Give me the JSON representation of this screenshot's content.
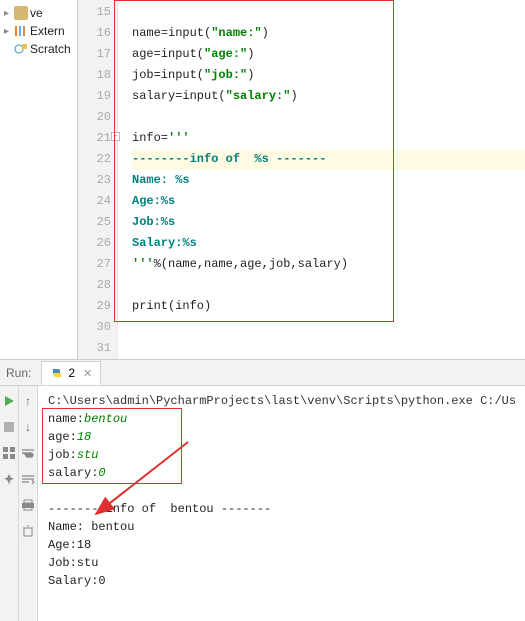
{
  "tree": {
    "venv": "ve",
    "external": "Extern",
    "scratches": "Scratch"
  },
  "editor": {
    "lines": [
      15,
      16,
      17,
      18,
      19,
      20,
      21,
      22,
      23,
      24,
      25,
      26,
      27,
      28,
      29,
      30,
      31
    ],
    "l16_a": "name=input(",
    "l16_b": "\"name:\"",
    "l16_c": ")",
    "l17_a": "age=input(",
    "l17_b": "\"age:\"",
    "l17_c": ")",
    "l18_a": "job=input(",
    "l18_b": "\"job:\"",
    "l18_c": ")",
    "l19_a": "salary=input(",
    "l19_b": "\"salary:\"",
    "l19_c": ")",
    "l21_a": "info=",
    "l21_b": "'''",
    "l22": "--------info of  %s -------",
    "l23": "Name: %s",
    "l24": "Age:%s",
    "l25": "Job:%s",
    "l26": "Salary:%s",
    "l27_a": "'''",
    "l27_b": "%(name,name,age,job,salary)",
    "l29": "print(info)"
  },
  "run": {
    "label": "Run:",
    "tab_name": "2",
    "path": "C:\\Users\\admin\\PycharmProjects\\last\\venv\\Scripts\\python.exe C:/Us",
    "in1_k": "name:",
    "in1_v": "bentou",
    "in2_k": "age:",
    "in2_v": "18",
    "in3_k": "job:",
    "in3_v": "stu",
    "in4_k": "salary:",
    "in4_v": "0",
    "out1": "--------info of  bentou -------",
    "out2": "Name: bentou",
    "out3": "Age:18",
    "out4": "Job:stu",
    "out5": "Salary:0"
  }
}
